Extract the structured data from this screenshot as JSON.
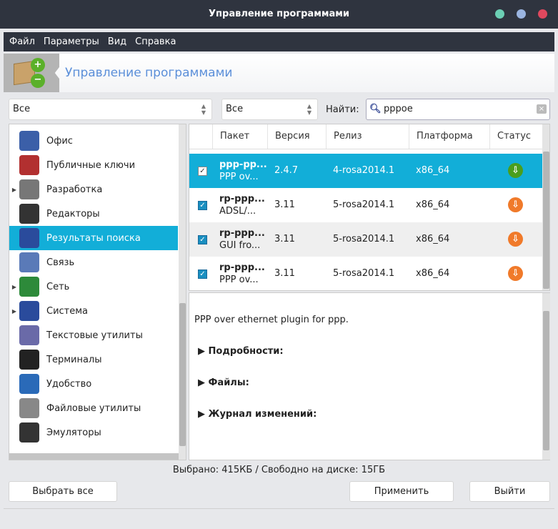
{
  "window": {
    "title": "Управление программами"
  },
  "menu": [
    "Файл",
    "Параметры",
    "Вид",
    "Справка"
  ],
  "banner": {
    "title": "Управление программами"
  },
  "filters": {
    "group": "Все",
    "type": "Все",
    "search_label": "Найти:",
    "search_value": "pppoe"
  },
  "sidebar": {
    "items": [
      {
        "label": "Офис",
        "expandable": false
      },
      {
        "label": "Публичные ключи",
        "expandable": false
      },
      {
        "label": "Разработка",
        "expandable": true
      },
      {
        "label": "Редакторы",
        "expandable": false
      },
      {
        "label": "Результаты поиска",
        "expandable": false,
        "selected": true
      },
      {
        "label": "Связь",
        "expandable": false
      },
      {
        "label": "Сеть",
        "expandable": true
      },
      {
        "label": "Система",
        "expandable": true
      },
      {
        "label": "Текстовые утилиты",
        "expandable": false
      },
      {
        "label": "Терминалы",
        "expandable": false
      },
      {
        "label": "Удобство",
        "expandable": false
      },
      {
        "label": "Файловые утилиты",
        "expandable": false
      },
      {
        "label": "Эмуляторы",
        "expandable": false
      }
    ]
  },
  "table": {
    "columns": [
      "Пакет",
      "Версия",
      "Релиз",
      "Платформа",
      "Статус"
    ],
    "rows": [
      {
        "name": "ppp-pp...",
        "summary": "PPP ov...",
        "version": "2.4.7",
        "release": "4-rosa2014.1",
        "platform": "x86_64",
        "checked": true,
        "status": "installed"
      },
      {
        "name": "rp-ppp...",
        "summary": "ADSL/...",
        "version": "3.11",
        "release": "5-rosa2014.1",
        "platform": "x86_64",
        "checked": true,
        "status": "to-install"
      },
      {
        "name": "rp-ppp...",
        "summary": "GUI fro...",
        "version": "3.11",
        "release": "5-rosa2014.1",
        "platform": "x86_64",
        "checked": true,
        "status": "to-install"
      },
      {
        "name": "rp-ppp...",
        "summary": "PPP ov...",
        "version": "3.11",
        "release": "5-rosa2014.1",
        "platform": "x86_64",
        "checked": true,
        "status": "to-install"
      }
    ]
  },
  "details": {
    "description": "PPP over ethernet plugin for ppp.",
    "sections": [
      "Подробности:",
      "Файлы:",
      "Журнал изменений:"
    ]
  },
  "statusbar": "Выбрано: 415КБ / Свободно на диске: 15ГБ",
  "buttons": {
    "select_all": "Выбрать все",
    "apply": "Применить",
    "quit": "Выйти"
  },
  "colors": {
    "accent": "#12aed8",
    "titlebar": "#2f343f",
    "installed": "#4a9e1c",
    "to_install": "#f07a2a"
  }
}
